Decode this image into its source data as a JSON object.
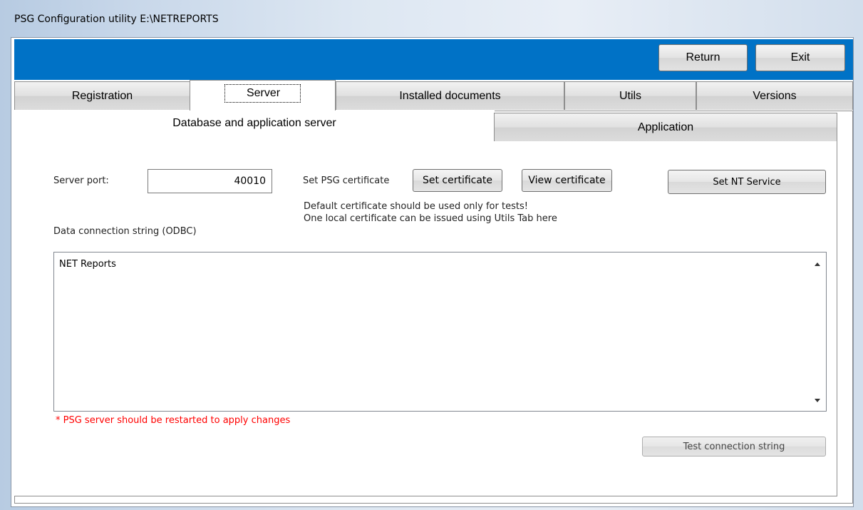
{
  "window": {
    "title": "PSG Configuration utility   E:\\NETREPORTS"
  },
  "toolbar": {
    "return_label": "Return",
    "exit_label": "Exit"
  },
  "main_tabs": [
    {
      "label": "Registration"
    },
    {
      "label": "Server",
      "active": true
    },
    {
      "label": "Installed documents"
    },
    {
      "label": "Utils"
    },
    {
      "label": "Versions"
    }
  ],
  "sub_tabs": [
    {
      "label": "Database and application server",
      "active": true
    },
    {
      "label": "Application"
    }
  ],
  "server": {
    "port_label": "Server port:",
    "port_value": "40010",
    "cert_label": "Set PSG certificate",
    "set_cert_button": "Set certificate",
    "view_cert_button": "View certificate",
    "nt_service_button": "Set NT Service",
    "cert_note_1": "Default certificate should be used only for tests!",
    "cert_note_2": "One local certificate can be issued using Utils Tab here",
    "conn_label": "Data connection string (ODBC)",
    "conn_value": "NET Reports",
    "restart_warning": "* PSG server should be restarted to apply changes",
    "test_button": "Test connection string"
  },
  "colors": {
    "header_bar": "#0072c6",
    "warning": "#ff0000"
  }
}
